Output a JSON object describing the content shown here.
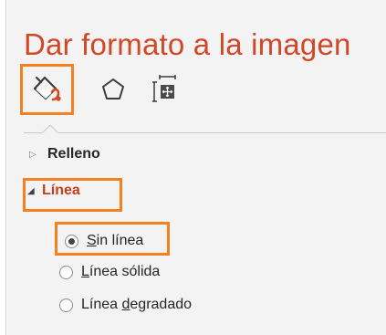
{
  "pane": {
    "title": "Dar formato a la imagen",
    "tabs": [
      {
        "name": "fill-and-line",
        "icon": "paint-bucket-icon",
        "selected": true
      },
      {
        "name": "effects",
        "icon": "pentagon-icon",
        "selected": false
      },
      {
        "name": "size-and-properties",
        "icon": "size-properties-icon",
        "selected": false
      }
    ]
  },
  "sections": {
    "relleno": {
      "label": "Relleno",
      "expanded": false,
      "expander_icon": "triangle-right-icon"
    },
    "linea": {
      "label": "Línea",
      "expanded": true,
      "expander_icon": "triangle-down-icon"
    }
  },
  "line_options": [
    {
      "access_key": "S",
      "rest": "in línea",
      "selected": true
    },
    {
      "access_key": "L",
      "rest": "ínea sólida",
      "selected": false
    },
    {
      "prefix": "Línea ",
      "access_key": "d",
      "rest": "egradado",
      "selected": false
    }
  ],
  "colors": {
    "title": "#d24726",
    "highlight": "#f4801f",
    "pane_background": "#f3f3f3",
    "active_section": "#c43e1c"
  }
}
